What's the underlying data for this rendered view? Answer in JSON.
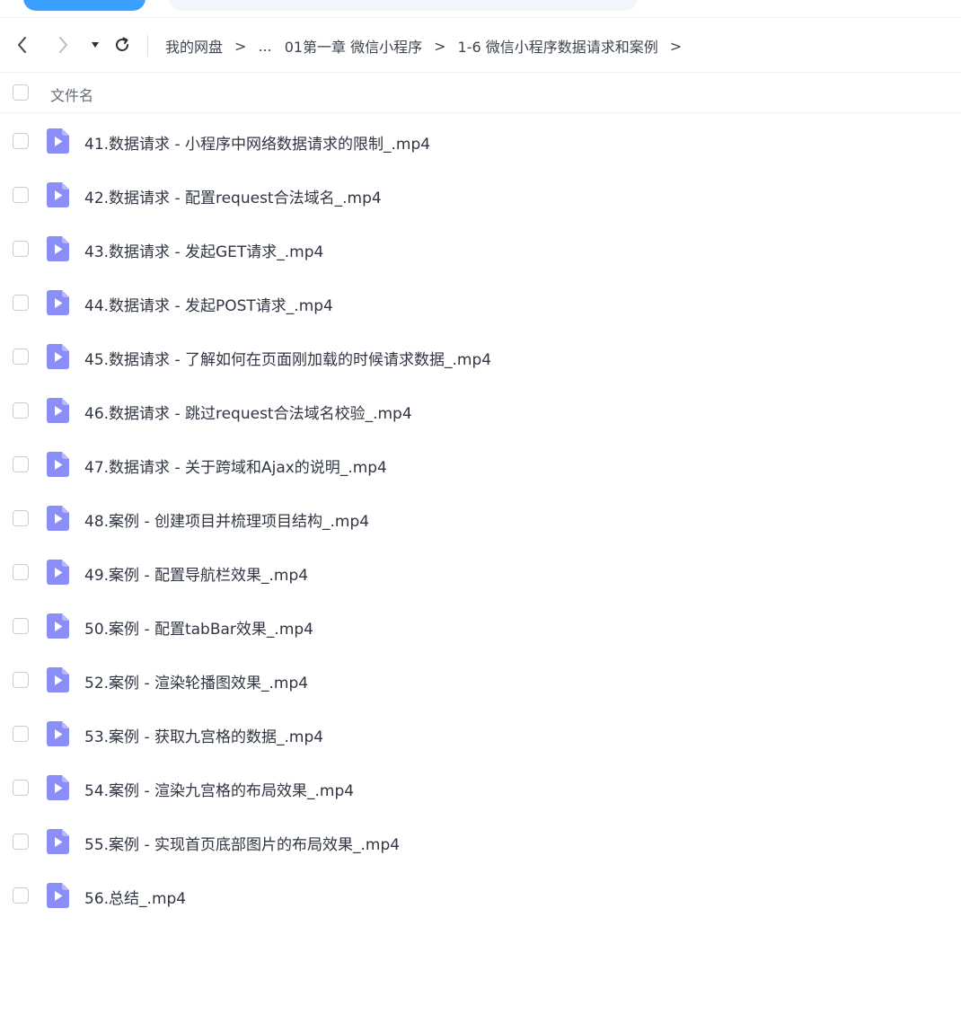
{
  "breadcrumb": {
    "root": "我的网盘",
    "ellipsis": "...",
    "chapter": "01第一章 微信小程序",
    "current": "1-6 微信小程序数据请求和案例",
    "separator": ">"
  },
  "list_header": {
    "label": "文件名"
  },
  "files": [
    {
      "name": "41.数据请求 - 小程序中网络数据请求的限制_.mp4"
    },
    {
      "name": "42.数据请求 - 配置request合法域名_.mp4"
    },
    {
      "name": "43.数据请求 - 发起GET请求_.mp4"
    },
    {
      "name": "44.数据请求 - 发起POST请求_.mp4"
    },
    {
      "name": "45.数据请求 - 了解如何在页面刚加载的时候请求数据_.mp4"
    },
    {
      "name": "46.数据请求 - 跳过request合法域名校验_.mp4"
    },
    {
      "name": "47.数据请求 - 关于跨域和Ajax的说明_.mp4"
    },
    {
      "name": "48.案例 - 创建项目并梳理项目结构_.mp4"
    },
    {
      "name": "49.案例 - 配置导航栏效果_.mp4"
    },
    {
      "name": "50.案例 - 配置tabBar效果_.mp4"
    },
    {
      "name": "52.案例 - 渲染轮播图效果_.mp4"
    },
    {
      "name": "53.案例 - 获取九宫格的数据_.mp4"
    },
    {
      "name": "54.案例 - 渲染九宫格的布局效果_.mp4"
    },
    {
      "name": "55.案例 - 实现首页底部图片的布局效果_.mp4"
    },
    {
      "name": "56.总结_.mp4"
    }
  ],
  "icons": {
    "back": "chevron-left-icon",
    "forward": "chevron-right-icon",
    "history": "caret-down-icon",
    "refresh": "refresh-icon",
    "file": "video-file-icon"
  },
  "colors": {
    "accent": "#3aa0ff",
    "video_icon": "#8c8ef7",
    "text": "#2f3542"
  }
}
